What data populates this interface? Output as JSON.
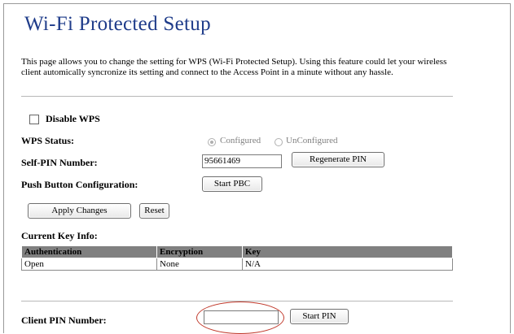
{
  "page": {
    "title": "Wi-Fi Protected Setup",
    "description": "This page allows you to change the setting for WPS (Wi-Fi Protected Setup). Using this feature could let your wireless client automically syncronize its setting and connect to the Access Point in a minute without any hassle."
  },
  "disable_wps": {
    "label": "Disable WPS",
    "checked": false
  },
  "wps_status": {
    "label": "WPS Status:",
    "options": [
      "Configured",
      "UnConfigured"
    ],
    "selected": "Configured"
  },
  "self_pin": {
    "label": "Self-PIN Number:",
    "value": "95661469",
    "regenerate_label": "Regenerate PIN"
  },
  "pbc": {
    "label": "Push Button Configuration:",
    "start_label": "Start PBC"
  },
  "actions": {
    "apply_label": "Apply Changes",
    "reset_label": "Reset"
  },
  "key_info": {
    "label": "Current Key Info:",
    "headers": [
      "Authentication",
      "Encryption",
      "Key"
    ],
    "rows": [
      [
        "Open",
        "None",
        "N/A"
      ]
    ]
  },
  "client_pin": {
    "label": "Client PIN Number:",
    "value": "",
    "start_label": "Start PIN"
  },
  "colors": {
    "title": "#1f3c8a",
    "table_header": "#808080",
    "annotation": "#c0392b"
  }
}
